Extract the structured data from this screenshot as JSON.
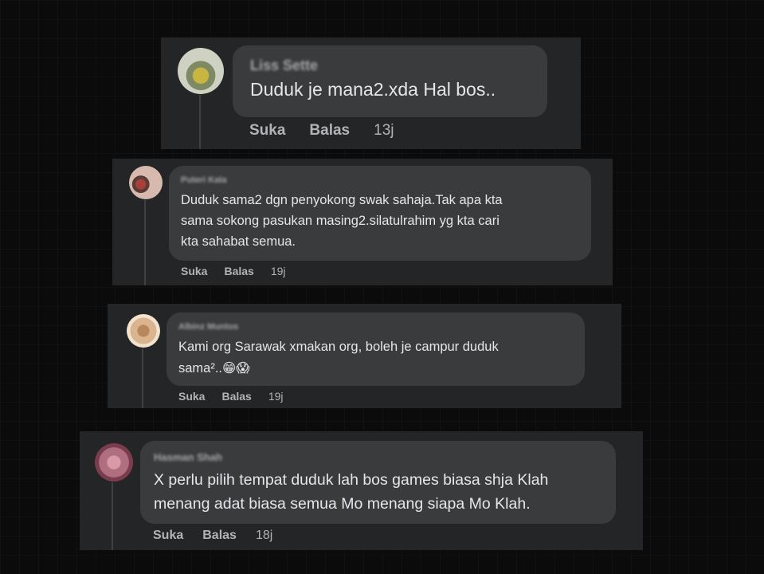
{
  "comments": [
    {
      "author": "Liss Sette",
      "text": "Duduk je mana2.xda Hal bos..",
      "actions": {
        "like": "Suka",
        "reply": "Balas",
        "time": "13j"
      },
      "avatar_colors": [
        "#cfd2c3",
        "#c9b640",
        "#7d8a63"
      ]
    },
    {
      "author": "Puteri Kala",
      "text_lines": [
        "Duduk sama2 dgn penyokong swak sahaja.Tak apa kta",
        "sama sokong pasukan masing2.silatulrahim yg kta cari",
        "kta sahabat semua."
      ],
      "actions": {
        "like": "Suka",
        "reply": "Balas",
        "time": "19j"
      },
      "avatar_colors": [
        "#d8b9ad",
        "#a8403a",
        "#5a3b35"
      ]
    },
    {
      "author": "Albinz Muntos",
      "text_lines": [
        "Kami org Sarawak xmakan org, boleh je campur duduk",
        "sama²..😁😱"
      ],
      "actions": {
        "like": "Suka",
        "reply": "Balas",
        "time": "19j"
      },
      "avatar_colors": [
        "#d9b48e",
        "#b8875c",
        "#f2e3cf"
      ]
    },
    {
      "author": "Hasman Shah",
      "text_lines": [
        "X perlu pilih tempat duduk lah bos games biasa shja Klah",
        "menang adat biasa semua Mo menang siapa Mo Klah."
      ],
      "actions": {
        "like": "Suka",
        "reply": "Balas",
        "time": "18j"
      },
      "avatar_colors": [
        "#b06f80",
        "#d99aa8",
        "#7a3d4e"
      ]
    }
  ],
  "colors": {
    "card_bg": "#242526",
    "bubble_bg": "#3a3b3c",
    "text": "#e4e6eb",
    "muted": "#b0b3b8"
  }
}
